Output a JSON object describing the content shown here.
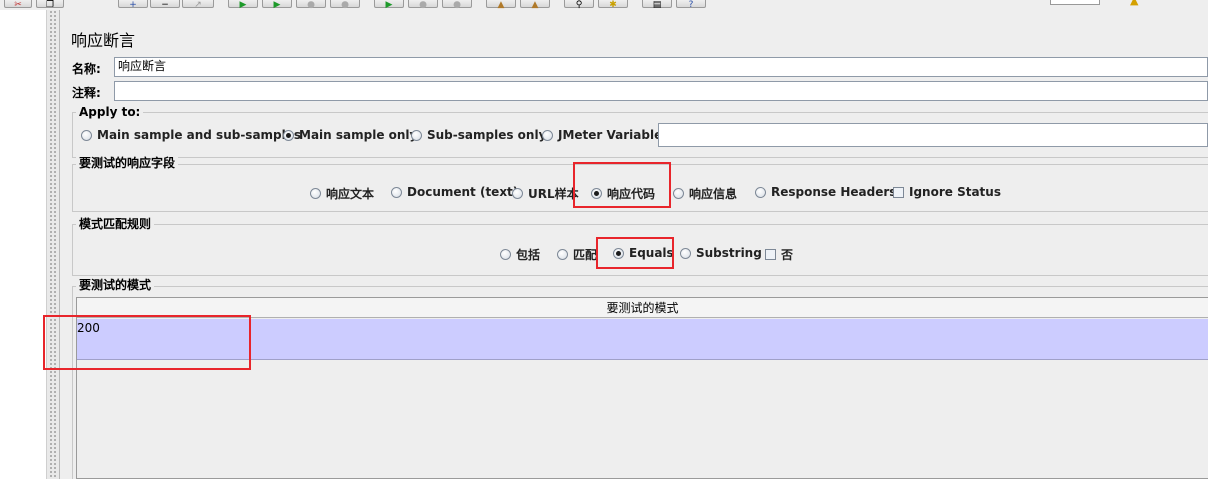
{
  "toolbar": {
    "icons": [
      "scissors-icon",
      "copy-icon",
      "paste-icon",
      "expand-icon",
      "collapse-icon",
      "toggle-icon",
      "start-icon",
      "start-no-pause-icon",
      "stop-icon",
      "shutdown-icon",
      "remote-start-icon",
      "remote-stop-icon",
      "remote-shutdown-icon",
      "clear-icon",
      "clear-all-icon",
      "search-icon",
      "reset-search-icon",
      "function-helper-icon",
      "help-icon",
      "warning-icon"
    ]
  },
  "panel": {
    "title": "响应断言",
    "name_label": "名称:",
    "name_value": "响应断言",
    "comment_label": "注释:",
    "comment_value": ""
  },
  "apply_to": {
    "legend": "Apply to:",
    "options": [
      "Main sample and sub-samples",
      "Main sample only",
      "Sub-samples only",
      "JMeter Variable"
    ],
    "selected": "Main sample only",
    "variable_value": ""
  },
  "response_field": {
    "legend": "要测试的响应字段",
    "options": [
      "响应文本",
      "Document (text)",
      "URL样本",
      "响应代码",
      "响应信息",
      "Response Headers"
    ],
    "selected": "响应代码",
    "ignore_status_label": "Ignore Status",
    "ignore_status_checked": false
  },
  "pattern_rules": {
    "legend": "模式匹配规则",
    "options": [
      "包括",
      "匹配",
      "Equals",
      "Substring"
    ],
    "selected": "Equals",
    "not_label": "否",
    "not_checked": false
  },
  "patterns": {
    "legend": "要测试的模式",
    "column_header": "要测试的模式",
    "rows": [
      "200"
    ]
  },
  "colors": {
    "highlight": "#e8252b",
    "selected_row": "#ccccff",
    "panel_bg": "#eeeeee"
  }
}
